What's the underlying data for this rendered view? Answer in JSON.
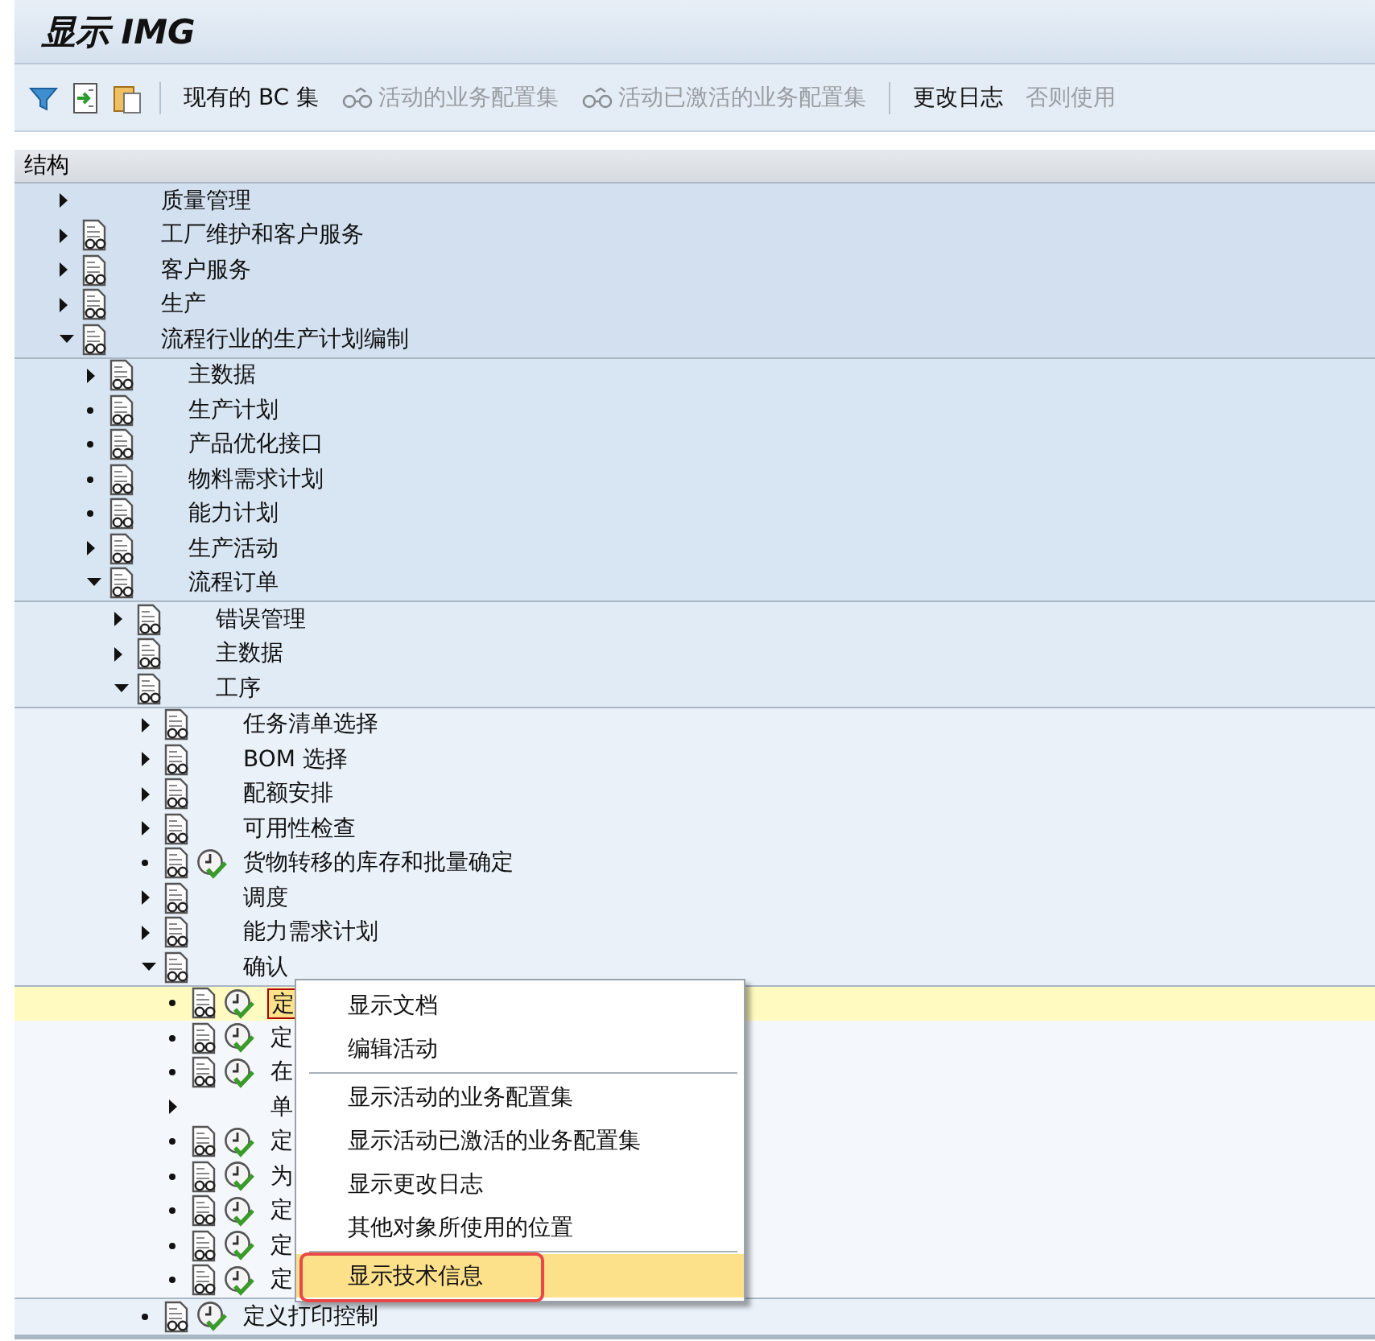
{
  "window": {
    "title": "显示 IMG"
  },
  "toolbar": {
    "buttons": [
      {
        "label": "现有的 BC 集",
        "kind": "text",
        "disabled": false
      },
      {
        "label": "活动的业务配置集",
        "kind": "glasses",
        "disabled": true
      },
      {
        "label": "活动已激活的业务配置集",
        "kind": "glasses",
        "disabled": true
      },
      {
        "label": "更改日志",
        "kind": "text",
        "disabled": false,
        "separator_before": true
      },
      {
        "label": "否则使用",
        "kind": "text",
        "disabled": true
      }
    ]
  },
  "tree": {
    "header": "结构",
    "nodes": [
      {
        "label": "质量管理",
        "expandable": true,
        "expanded": false,
        "doc": false,
        "activity": false,
        "selected": false
      },
      {
        "label": "工厂维护和客户服务",
        "expandable": true,
        "expanded": false,
        "doc": true,
        "activity": false,
        "selected": false
      },
      {
        "label": "客户服务",
        "expandable": true,
        "expanded": false,
        "doc": true,
        "activity": false,
        "selected": false
      },
      {
        "label": "生产",
        "expandable": true,
        "expanded": false,
        "doc": true,
        "activity": false,
        "selected": false
      },
      {
        "label": "流程行业的生产计划编制",
        "expandable": true,
        "expanded": true,
        "doc": true,
        "activity": false,
        "selected": false,
        "children": [
          {
            "label": "主数据",
            "expandable": true,
            "expanded": false,
            "doc": true,
            "activity": false,
            "selected": false
          },
          {
            "label": "生产计划",
            "expandable": false,
            "doc": true,
            "activity": false,
            "selected": false
          },
          {
            "label": "产品优化接口",
            "expandable": false,
            "doc": true,
            "activity": false,
            "selected": false
          },
          {
            "label": "物料需求计划",
            "expandable": false,
            "doc": true,
            "activity": false,
            "selected": false
          },
          {
            "label": "能力计划",
            "expandable": false,
            "doc": true,
            "activity": false,
            "selected": false
          },
          {
            "label": "生产活动",
            "expandable": true,
            "expanded": false,
            "doc": true,
            "activity": false,
            "selected": false
          },
          {
            "label": "流程订单",
            "expandable": true,
            "expanded": true,
            "doc": true,
            "activity": false,
            "selected": false,
            "children": [
              {
                "label": "错误管理",
                "expandable": true,
                "expanded": false,
                "doc": true,
                "activity": false,
                "selected": false
              },
              {
                "label": "主数据",
                "expandable": true,
                "expanded": false,
                "doc": true,
                "activity": false,
                "selected": false
              },
              {
                "label": "工序",
                "expandable": true,
                "expanded": true,
                "doc": true,
                "activity": false,
                "selected": false,
                "children": [
                  {
                    "label": "任务清单选择",
                    "expandable": true,
                    "expanded": false,
                    "doc": true,
                    "activity": false,
                    "selected": false
                  },
                  {
                    "label": "BOM 选择",
                    "expandable": true,
                    "expanded": false,
                    "doc": true,
                    "activity": false,
                    "selected": false
                  },
                  {
                    "label": "配额安排",
                    "expandable": true,
                    "expanded": false,
                    "doc": true,
                    "activity": false,
                    "selected": false
                  },
                  {
                    "label": "可用性检查",
                    "expandable": true,
                    "expanded": false,
                    "doc": true,
                    "activity": false,
                    "selected": false
                  },
                  {
                    "label": "货物转移的库存和批量确定",
                    "expandable": false,
                    "doc": true,
                    "activity": true,
                    "selected": false
                  },
                  {
                    "label": "调度",
                    "expandable": true,
                    "expanded": false,
                    "doc": true,
                    "activity": false,
                    "selected": false
                  },
                  {
                    "label": "能力需求计划",
                    "expandable": true,
                    "expanded": false,
                    "doc": true,
                    "activity": false,
                    "selected": false
                  },
                  {
                    "label": "确认",
                    "expandable": true,
                    "expanded": true,
                    "doc": true,
                    "activity": false,
                    "selected": false,
                    "children": [
                      {
                        "label": "定",
                        "expandable": false,
                        "doc": true,
                        "activity": true,
                        "selected": true
                      },
                      {
                        "label": "定",
                        "expandable": false,
                        "doc": true,
                        "activity": true,
                        "selected": false
                      },
                      {
                        "label": "在",
                        "expandable": false,
                        "doc": true,
                        "activity": true,
                        "selected": false
                      },
                      {
                        "label": "单",
                        "expandable": true,
                        "expanded": false,
                        "doc": false,
                        "activity": false,
                        "selected": false
                      },
                      {
                        "label": "定",
                        "expandable": false,
                        "doc": true,
                        "activity": true,
                        "selected": false
                      },
                      {
                        "label": "为",
                        "expandable": false,
                        "doc": true,
                        "activity": true,
                        "selected": false
                      },
                      {
                        "label": "定",
                        "expandable": false,
                        "doc": true,
                        "activity": true,
                        "selected": false
                      },
                      {
                        "label": "定",
                        "expandable": false,
                        "doc": true,
                        "activity": true,
                        "selected": false
                      },
                      {
                        "label": "定",
                        "expandable": false,
                        "doc": true,
                        "activity": true,
                        "selected": false
                      }
                    ]
                  },
                  {
                    "label": "定义打印控制",
                    "expandable": false,
                    "doc": true,
                    "activity": true,
                    "selected": false
                  }
                ]
              }
            ]
          }
        ]
      }
    ]
  },
  "context_menu": {
    "items": [
      {
        "label": "显示文档",
        "selected": false,
        "marked": false
      },
      {
        "label": "编辑活动",
        "selected": false,
        "marked": false
      },
      {
        "label": "显示活动的业务配置集",
        "selected": false,
        "marked": false,
        "separator_before": true
      },
      {
        "label": "显示活动已激活的业务配置集",
        "selected": false,
        "marked": false
      },
      {
        "label": "显示更改日志",
        "selected": false,
        "marked": false
      },
      {
        "label": "其他对象所使用的位置",
        "selected": false,
        "marked": false
      },
      {
        "label": "显示技术信息",
        "selected": true,
        "marked": true,
        "separator_before": true
      }
    ]
  }
}
